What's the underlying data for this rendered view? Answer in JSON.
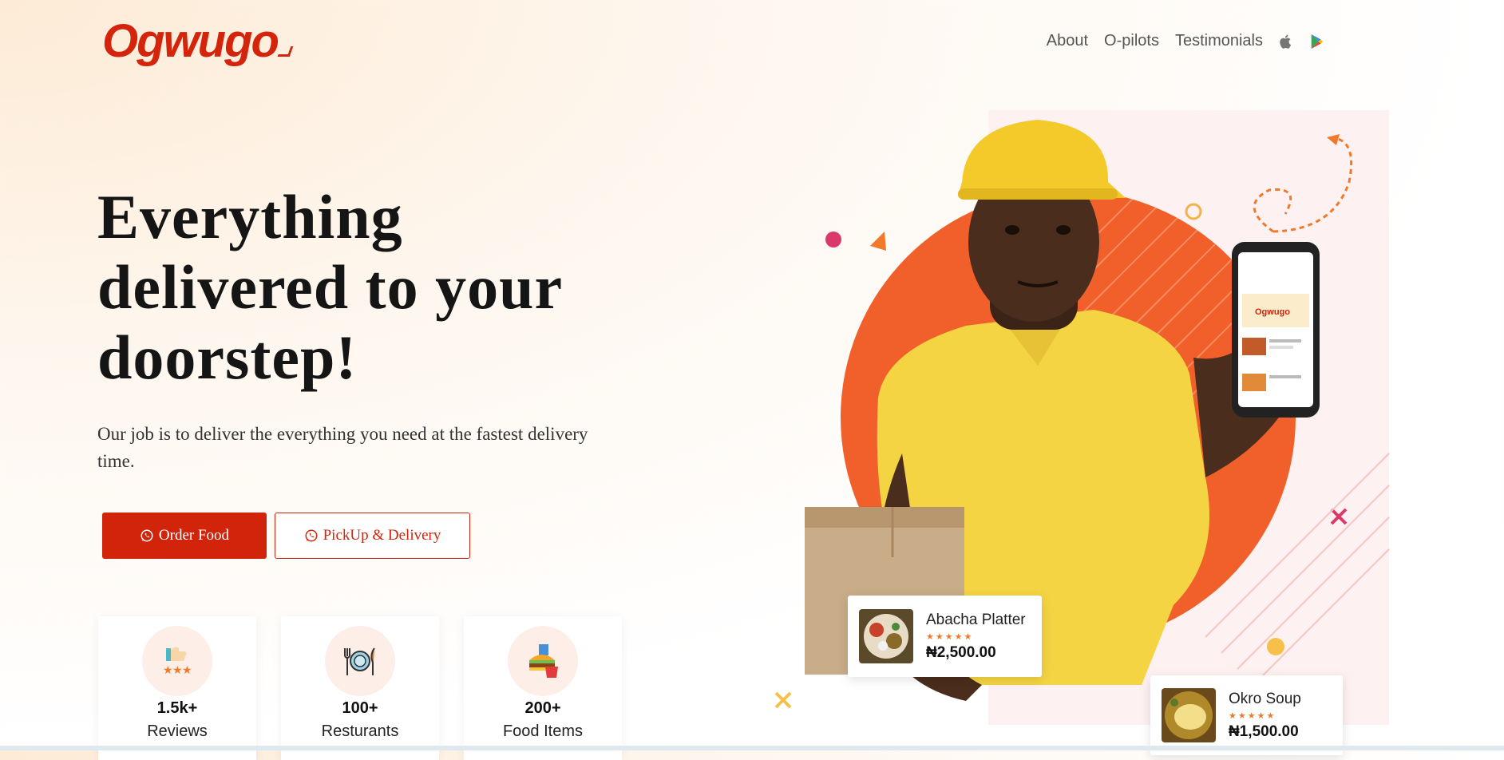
{
  "header": {
    "logo": "Ogwugo",
    "nav": [
      "About",
      "O-pilots",
      "Testimonials"
    ],
    "store_icons": [
      "apple-icon",
      "google-play-icon"
    ]
  },
  "hero": {
    "title_lines": [
      "Everything",
      "delivered to your",
      "doorstep!"
    ],
    "subtitle": "Our job is to deliver the everything you need at the fastest delivery time.",
    "primary_button": "Order Food",
    "secondary_button": "PickUp & Delivery",
    "button_icon": "whatsapp-icon"
  },
  "stats": [
    {
      "value": "1.5k+",
      "label": "Reviews",
      "icon": "thumbs-up-stars-icon"
    },
    {
      "value": "100+",
      "label": "Resturants",
      "icon": "plate-cutlery-icon"
    },
    {
      "value": "200+",
      "label": "Food Items",
      "icon": "fast-food-icon"
    }
  ],
  "food_cards": [
    {
      "name": "Abacha Platter",
      "stars": "★★★★★",
      "price": "₦2,500.00"
    },
    {
      "name": "Okro Soup",
      "stars": "★★★★★",
      "price": "₦1,500.00"
    }
  ],
  "colors": {
    "brand": "#d2240b",
    "accent": "#f26a2e",
    "text": "#151515"
  }
}
